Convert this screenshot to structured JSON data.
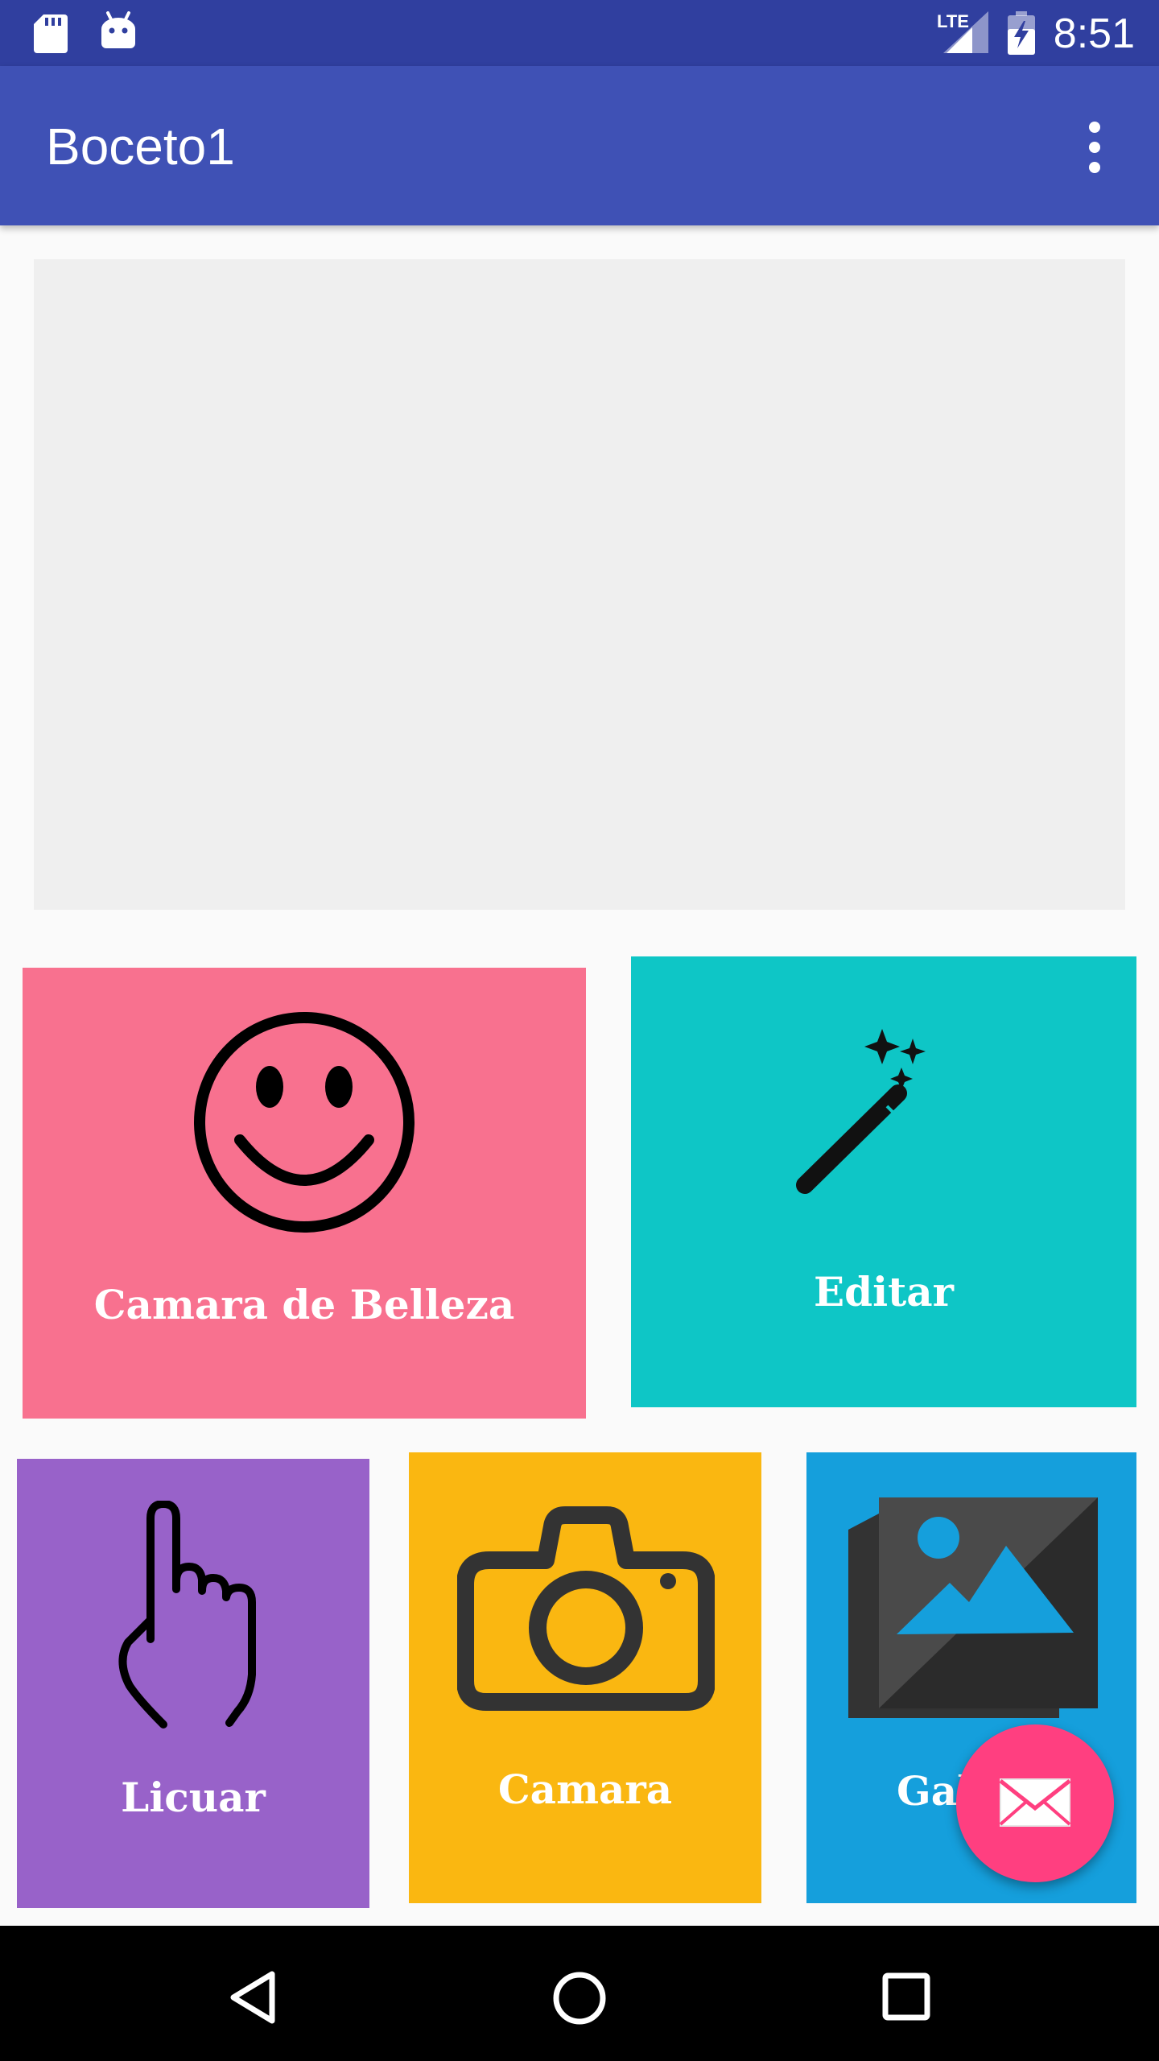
{
  "status_bar": {
    "time": "8:51",
    "network": "LTE"
  },
  "app_bar": {
    "title": "Boceto1",
    "overflow_icon": "more-vert-icon"
  },
  "tiles": [
    {
      "label": "Camara de Belleza",
      "icon": "smiley-face-icon",
      "color": "#f8718f"
    },
    {
      "label": "Editar",
      "icon": "magic-wand-icon",
      "color": "#0ec6c6"
    },
    {
      "label": "Licuar",
      "icon": "pointing-hand-icon",
      "color": "#9862c9"
    },
    {
      "label": "Camara",
      "icon": "camera-icon",
      "color": "#fab711"
    },
    {
      "label": "Gal",
      "icon": "gallery-icon",
      "color": "#159fdc"
    }
  ],
  "fab": {
    "icon": "mail-icon",
    "color": "#ff3f80"
  },
  "colors": {
    "primary": "#3f51b5",
    "primary_dark": "#303f9f"
  }
}
